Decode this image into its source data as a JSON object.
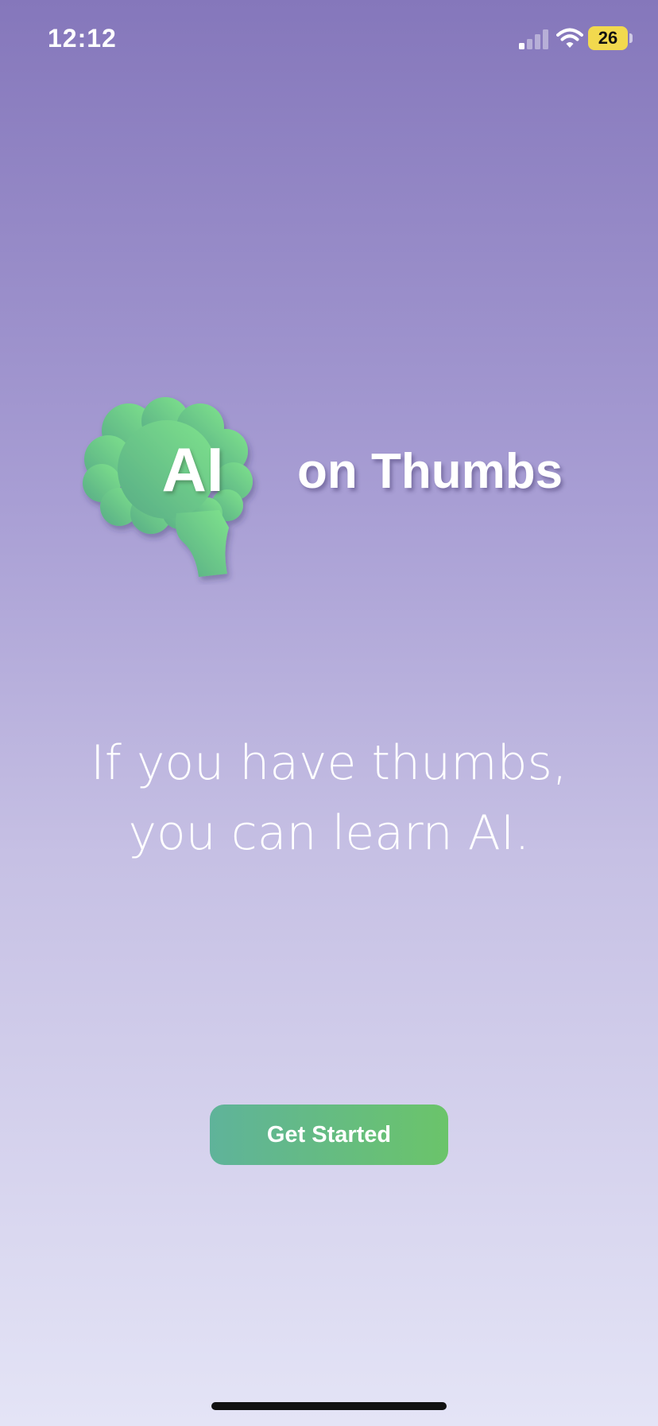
{
  "status_bar": {
    "time": "12:12",
    "battery_level": "26",
    "signal_icon": "cellular-signal-icon",
    "wifi_icon": "wifi-icon",
    "battery_color": "#f2d94e"
  },
  "logo": {
    "brand_mark": "AI",
    "brand_name": "on Thumbs",
    "icon": "brain-icon",
    "icon_color": "#6ccf86"
  },
  "tagline": {
    "line1": "If you have thumbs,",
    "line2": "you can learn AI."
  },
  "actions": {
    "get_started_label": "Get Started",
    "button_color": "#66bb7a"
  },
  "colors": {
    "background_top": "#8577bb",
    "background_bottom": "#e4e4f6"
  }
}
